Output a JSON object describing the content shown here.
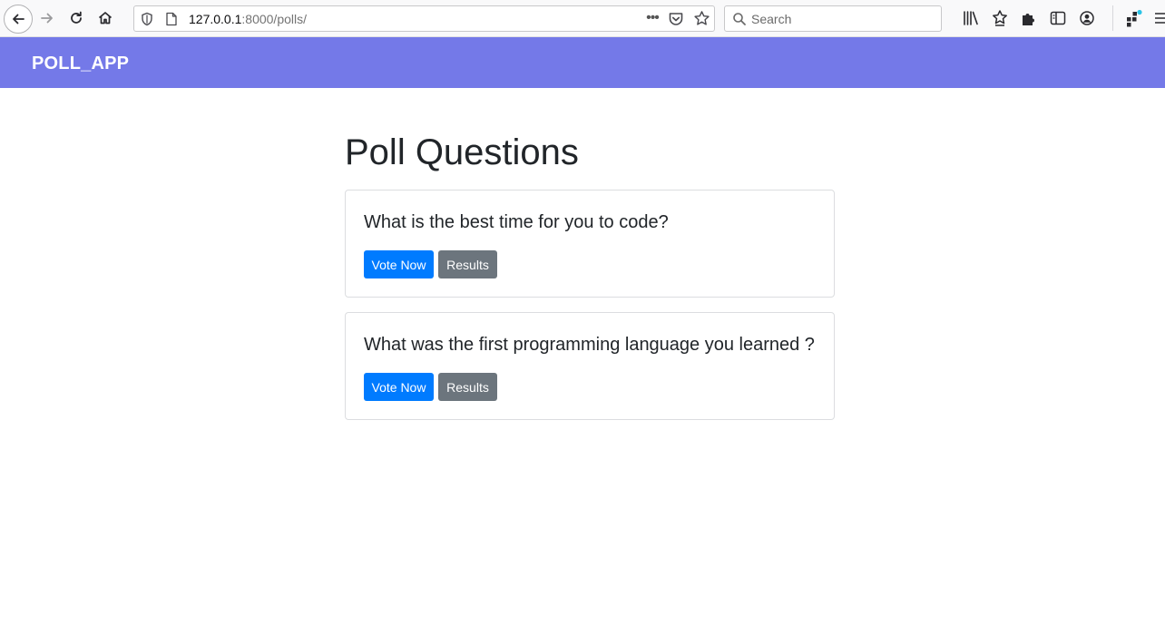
{
  "browser": {
    "url_host": "127.0.0.1",
    "url_path": ":8000/polls/",
    "search_placeholder": "Search",
    "more_label": "•••"
  },
  "navbar": {
    "brand": "POLL_APP",
    "color": "#7479e8"
  },
  "main": {
    "heading": "Poll Questions",
    "polls": [
      {
        "question": "What is the best time for you to code?",
        "vote_label": "Vote Now",
        "results_label": "Results"
      },
      {
        "question": "What was the first programming language you learned ?",
        "vote_label": "Vote Now",
        "results_label": "Results"
      }
    ]
  },
  "colors": {
    "vote_button": "#007bff",
    "results_button": "#6c757d"
  }
}
